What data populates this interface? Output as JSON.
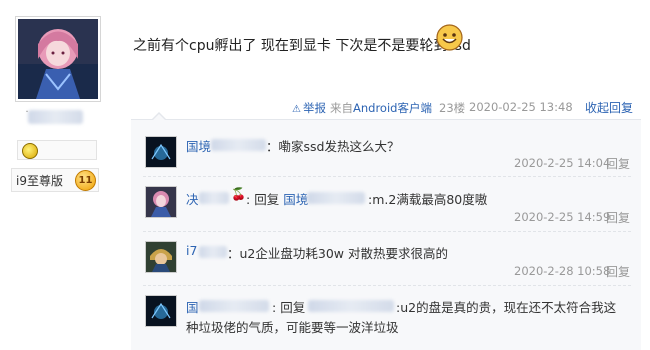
{
  "post": {
    "text": "之前有个cpu孵出了 现在到显卡 下次是不是要轮到ssd",
    "meta": {
      "report": "举报",
      "source_prefix": "来自",
      "source_app": "Android客户端",
      "floor": "23楼",
      "datetime": "2020-02-25 13:48",
      "fold": "收起回复"
    }
  },
  "user": {
    "vip_label": "i9至尊版",
    "level": "11"
  },
  "replies": [
    {
      "user": "国境",
      "colon": "：",
      "text": "嘞家ssd发热这么大？",
      "time": "2020-2-25 14:04",
      "reply_label": "回复"
    },
    {
      "user": "决",
      "reply_word": "回复",
      "reply_to": "国境",
      "text": ":m.2满载最高80度嗷",
      "time": "2020-2-25 14:59",
      "reply_label": "回复"
    },
    {
      "user": "i7",
      "text": "：u2企业盘功耗30w 对散热要求很高的",
      "time": "2020-2-28 10:58",
      "reply_label": "回复"
    },
    {
      "user": "国",
      "reply_word": "回复",
      "text_line1": ":u2的盘是真的贵，现在还不太符合我这",
      "text_line2": "种垃圾佬的气质，可能要等一波洋垃圾"
    }
  ],
  "colors": {
    "link": "#2d64b3",
    "muted": "#999999",
    "reply_bg": "#f7f8fa"
  }
}
